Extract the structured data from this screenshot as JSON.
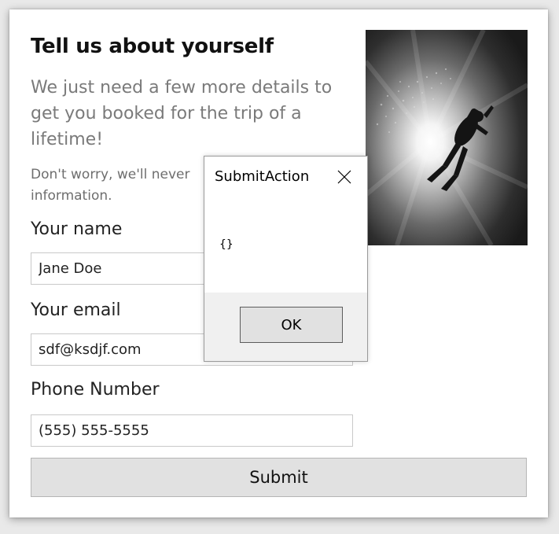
{
  "form": {
    "title": "Tell us about yourself",
    "subtitle": "We just need a few more details to get you booked for the trip of a lifetime!",
    "note": "Don't worry, we'll never information.",
    "name_label": "Your name",
    "name_value": "Jane Doe",
    "email_label": "Your email",
    "email_value": "sdf@ksdjf.com",
    "phone_label": "Phone Number",
    "phone_value": "(555) 555-5555",
    "submit_label": "Submit"
  },
  "dialog": {
    "title": "SubmitAction",
    "message": "{}",
    "ok_label": "OK",
    "close_icon": "close-icon"
  },
  "image": {
    "subject": "scuba-diver-silhouette"
  }
}
